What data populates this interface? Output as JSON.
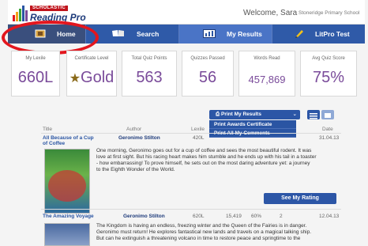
{
  "header": {
    "brand": "SCHOLASTIC",
    "product": "Reading Pro",
    "welcome": "Welcome, Sara",
    "school": "Stoneridge Primary School"
  },
  "nav": {
    "tabs": [
      {
        "label": "Home",
        "icon": "home-icon"
      },
      {
        "label": "Search",
        "icon": "book-icon"
      },
      {
        "label": "My Results",
        "icon": "chart-icon"
      },
      {
        "label": "LitPro Test",
        "icon": "pencil-icon"
      }
    ],
    "active": "My Results"
  },
  "stats": [
    {
      "label": "My Lexile",
      "value": "660L"
    },
    {
      "label": "Certificate Level",
      "value": "Gold"
    },
    {
      "label": "Total Quiz Points",
      "value": "563"
    },
    {
      "label": "Quizzes Passed",
      "value": "56"
    },
    {
      "label": "Words Read",
      "value": "457,869"
    },
    {
      "label": "Avg Quiz Score",
      "value": "75%"
    }
  ],
  "print_menu": {
    "button": "Print My Results",
    "items": [
      "Print Awards Certificate",
      "Print All My Comments"
    ]
  },
  "list": {
    "headers": {
      "title": "Title",
      "author": "Author",
      "lexile": "Lexile",
      "date": "Date"
    },
    "rows": [
      {
        "title_line1": "All Because of a Cup",
        "title_line2": "of Coffee",
        "author": "Geronimo Stilton",
        "lexile": "420L",
        "date": "31.04.13",
        "desc": [
          "One morning, Geronimo goes out for a cup of coffee and sees the most beautiful rodent. It was",
          "love at first sight. But his racing heart makes him stumble and he ends up with his tail in a toaster",
          "- how embarrassing! To prove himself, he sets out on the most daring adventure yet: a journey",
          "to the Eighth Wonder of the World."
        ],
        "rating_button": "See My Rating"
      },
      {
        "title_line1": "The Amazing Voyage",
        "author": "Geronimo Stilton",
        "lexile": "620L",
        "words": "15,419",
        "score": "60%",
        "points": "2",
        "date": "12.04.13",
        "desc": [
          "The Kingdom is having an endless, freezing winter and the Queen of the Fairies is in danger.",
          "Geronimo must return! He explores fantastical new lands and travels on a magical talking ship.",
          "But can he extinguish a threatening volcano in time to restore peace and springtime to the"
        ]
      }
    ]
  },
  "colors": {
    "nav": "#2a55a3",
    "accent_value": "#7a4b9a",
    "annotation": "#e3161e"
  }
}
